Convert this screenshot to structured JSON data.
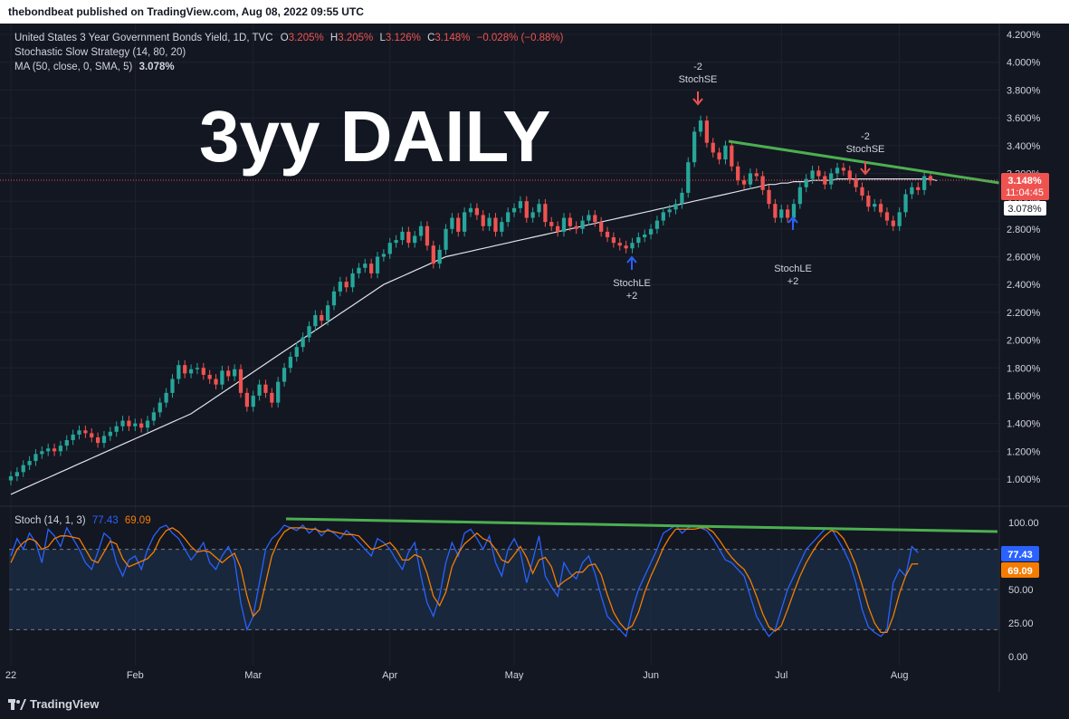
{
  "header": {
    "publish_line": "thebondbeat published on TradingView.com, Aug 08, 2022 09:55 UTC"
  },
  "colors": {
    "bg": "#131722",
    "up": "#26a69a",
    "down": "#ef5350",
    "ma": "#e0e3eb",
    "trend": "#4caf50",
    "stoch_k": "#2962ff",
    "stoch_d": "#f57c00",
    "text": "#d1d4dc",
    "band": "#1e3450"
  },
  "legend": {
    "title": "United States 3 Year Government Bonds Yield, 1D, TVC",
    "o_label": "O",
    "o_value": "3.205%",
    "h_label": "H",
    "h_value": "3.205%",
    "l_label": "L",
    "l_value": "3.126%",
    "c_label": "C",
    "c_value": "3.148%",
    "change": "−0.028% (−0.88%)",
    "strategy": "Stochastic Slow Strategy (14, 80, 20)",
    "ma_label": "MA (50, close, 0, SMA, 5)",
    "ma_value": "3.078%"
  },
  "overlay_title": "3yy DAILY",
  "signals": {
    "se1_qty": "-2",
    "se1_name": "StochSE",
    "se2_qty": "-2",
    "se2_name": "StochSE",
    "le1_name": "StochLE",
    "le1_qty": "+2",
    "le2_name": "StochLE",
    "le2_qty": "+2"
  },
  "price_badges": {
    "last": "3.148%",
    "countdown": "11:04:45",
    "ma": "3.078%"
  },
  "stoch": {
    "label": "Stoch (14, 1, 3)",
    "k_value": "77.43",
    "d_value": "69.09"
  },
  "footer": {
    "brand": "TradingView"
  },
  "chart_data": [
    {
      "type": "candlestick",
      "title": "United States 3 Year Government Bonds Yield, 1D, TVC",
      "y_unit": "%",
      "ylim": [
        0.8,
        4.3
      ],
      "y_ticks": [
        1.0,
        1.2,
        1.4,
        1.6,
        1.8,
        2.0,
        2.2,
        2.4,
        2.6,
        2.8,
        3.0,
        3.2,
        3.4,
        3.6,
        3.8,
        4.0,
        4.2
      ],
      "y_tick_labels": [
        "1.000%",
        "1.200%",
        "1.400%",
        "1.600%",
        "1.800%",
        "2.000%",
        "2.200%",
        "2.400%",
        "2.600%",
        "2.800%",
        "3.000%",
        "3.200%",
        "3.400%",
        "3.600%",
        "3.800%",
        "4.000%",
        "4.200%"
      ],
      "x_ticks": [
        {
          "label": "22",
          "idx": 0
        },
        {
          "label": "Feb",
          "idx": 20
        },
        {
          "label": "Mar",
          "idx": 39
        },
        {
          "label": "Apr",
          "idx": 61
        },
        {
          "label": "May",
          "idx": 81
        },
        {
          "label": "Jun",
          "idx": 103
        },
        {
          "label": "Jul",
          "idx": 124
        },
        {
          "label": "Aug",
          "idx": 143
        }
      ],
      "close": [
        1.02,
        1.05,
        1.1,
        1.13,
        1.18,
        1.2,
        1.22,
        1.2,
        1.24,
        1.28,
        1.32,
        1.35,
        1.33,
        1.3,
        1.26,
        1.31,
        1.34,
        1.38,
        1.42,
        1.38,
        1.4,
        1.37,
        1.42,
        1.48,
        1.55,
        1.62,
        1.72,
        1.82,
        1.76,
        1.79,
        1.8,
        1.75,
        1.72,
        1.68,
        1.78,
        1.74,
        1.79,
        1.62,
        1.52,
        1.6,
        1.68,
        1.62,
        1.55,
        1.7,
        1.8,
        1.88,
        1.95,
        2.02,
        2.1,
        2.18,
        2.14,
        2.25,
        2.35,
        2.42,
        2.38,
        2.48,
        2.52,
        2.55,
        2.48,
        2.6,
        2.62,
        2.7,
        2.72,
        2.78,
        2.7,
        2.75,
        2.82,
        2.68,
        2.55,
        2.65,
        2.8,
        2.88,
        2.78,
        2.92,
        2.95,
        2.9,
        2.82,
        2.88,
        2.78,
        2.85,
        2.92,
        2.95,
        3.0,
        2.88,
        2.92,
        2.98,
        2.85,
        2.82,
        2.78,
        2.88,
        2.82,
        2.8,
        2.86,
        2.9,
        2.85,
        2.78,
        2.74,
        2.7,
        2.68,
        2.66,
        2.7,
        2.74,
        2.76,
        2.8,
        2.86,
        2.92,
        2.94,
        2.98,
        3.06,
        3.28,
        3.5,
        3.58,
        3.42,
        3.35,
        3.3,
        3.4,
        3.25,
        3.15,
        3.12,
        3.2,
        3.18,
        3.08,
        2.98,
        2.88,
        2.94,
        2.88,
        2.98,
        3.1,
        3.16,
        3.22,
        3.18,
        3.12,
        3.2,
        3.24,
        3.22,
        3.16,
        3.1,
        3.04,
        2.96,
        2.98,
        2.92,
        2.86,
        2.82,
        2.92,
        3.05,
        3.1,
        3.08,
        3.18,
        3.148
      ],
      "ma50": [
        0.89,
        0.91,
        0.93,
        0.95,
        0.97,
        0.99,
        1.01,
        1.03,
        1.05,
        1.07,
        1.09,
        1.11,
        1.13,
        1.15,
        1.17,
        1.19,
        1.21,
        1.23,
        1.25,
        1.27,
        1.29,
        1.31,
        1.33,
        1.35,
        1.37,
        1.39,
        1.41,
        1.43,
        1.45,
        1.47,
        1.5,
        1.53,
        1.56,
        1.59,
        1.62,
        1.65,
        1.68,
        1.71,
        1.74,
        1.77,
        1.8,
        1.83,
        1.86,
        1.89,
        1.92,
        1.95,
        1.98,
        2.01,
        2.04,
        2.07,
        2.1,
        2.13,
        2.16,
        2.19,
        2.22,
        2.25,
        2.28,
        2.31,
        2.34,
        2.37,
        2.4,
        2.42,
        2.44,
        2.46,
        2.48,
        2.5,
        2.52,
        2.54,
        2.56,
        2.58,
        2.6,
        2.61,
        2.62,
        2.63,
        2.64,
        2.65,
        2.66,
        2.67,
        2.68,
        2.69,
        2.7,
        2.71,
        2.72,
        2.73,
        2.74,
        2.75,
        2.76,
        2.77,
        2.78,
        2.79,
        2.8,
        2.81,
        2.82,
        2.83,
        2.84,
        2.85,
        2.86,
        2.87,
        2.88,
        2.89,
        2.9,
        2.91,
        2.92,
        2.93,
        2.94,
        2.95,
        2.96,
        2.97,
        2.98,
        2.99,
        3.0,
        3.01,
        3.02,
        3.03,
        3.04,
        3.05,
        3.06,
        3.07,
        3.08,
        3.09,
        3.1,
        3.11,
        3.12,
        3.12,
        3.13,
        3.13,
        3.14,
        3.14,
        3.14,
        3.15,
        3.15,
        3.15,
        3.15,
        3.16,
        3.16,
        3.16,
        3.16,
        3.16,
        3.16,
        3.16,
        3.16,
        3.16,
        3.16,
        3.16,
        3.16,
        3.16,
        3.16,
        3.16,
        3.16,
        3.148
      ]
    },
    {
      "type": "line",
      "title": "Stoch (14, 1, 3)",
      "ylim": [
        0,
        100
      ],
      "y_ticks": [
        0,
        25,
        50,
        100
      ],
      "y_tick_labels": [
        "0.00",
        "25.00",
        "50.00",
        "100.00"
      ],
      "bands": [
        20,
        80
      ],
      "series": [
        {
          "name": "%K",
          "color": "#2962ff",
          "values": [
            75,
            88,
            80,
            92,
            85,
            70,
            95,
            90,
            82,
            96,
            88,
            80,
            70,
            65,
            78,
            92,
            88,
            70,
            60,
            72,
            75,
            65,
            80,
            90,
            96,
            98,
            92,
            88,
            80,
            72,
            78,
            85,
            70,
            65,
            75,
            82,
            72,
            40,
            20,
            30,
            55,
            80,
            88,
            92,
            98,
            96,
            94,
            98,
            92,
            96,
            90,
            95,
            92,
            88,
            94,
            90,
            85,
            80,
            75,
            88,
            85,
            80,
            72,
            65,
            78,
            85,
            60,
            40,
            30,
            45,
            70,
            85,
            75,
            92,
            95,
            88,
            80,
            90,
            70,
            60,
            80,
            88,
            78,
            55,
            72,
            90,
            60,
            52,
            45,
            70,
            62,
            58,
            70,
            75,
            62,
            45,
            30,
            25,
            20,
            15,
            35,
            50,
            60,
            70,
            80,
            92,
            95,
            98,
            92,
            96,
            98,
            96,
            94,
            88,
            80,
            72,
            70,
            65,
            60,
            45,
            30,
            22,
            15,
            20,
            35,
            50,
            60,
            70,
            80,
            85,
            90,
            95,
            96,
            88,
            80,
            70,
            55,
            35,
            22,
            18,
            15,
            20,
            55,
            65,
            60,
            82,
            77.43
          ]
        },
        {
          "name": "%D",
          "color": "#f57c00",
          "values": [
            70,
            80,
            85,
            88,
            86,
            80,
            82,
            88,
            90,
            90,
            89,
            88,
            80,
            72,
            70,
            78,
            86,
            84,
            73,
            67,
            69,
            71,
            73,
            78,
            88,
            94,
            96,
            93,
            88,
            82,
            78,
            79,
            78,
            74,
            70,
            74,
            77,
            66,
            45,
            30,
            35,
            55,
            75,
            86,
            93,
            96,
            96,
            96,
            95,
            95,
            93,
            94,
            93,
            92,
            91,
            91,
            90,
            85,
            80,
            81,
            83,
            85,
            80,
            72,
            72,
            76,
            74,
            62,
            45,
            38,
            48,
            67,
            77,
            84,
            88,
            92,
            88,
            86,
            80,
            72,
            70,
            76,
            82,
            74,
            62,
            72,
            74,
            67,
            52,
            56,
            59,
            63,
            63,
            68,
            69,
            61,
            46,
            33,
            25,
            20,
            23,
            33,
            48,
            60,
            70,
            81,
            89,
            95,
            95,
            95,
            95,
            96,
            96,
            93,
            87,
            80,
            74,
            69,
            65,
            57,
            45,
            32,
            22,
            19,
            23,
            35,
            48,
            60,
            70,
            78,
            85,
            90,
            94,
            93,
            88,
            79,
            68,
            53,
            37,
            25,
            18,
            18,
            30,
            47,
            60,
            69,
            69.09
          ]
        }
      ]
    }
  ]
}
